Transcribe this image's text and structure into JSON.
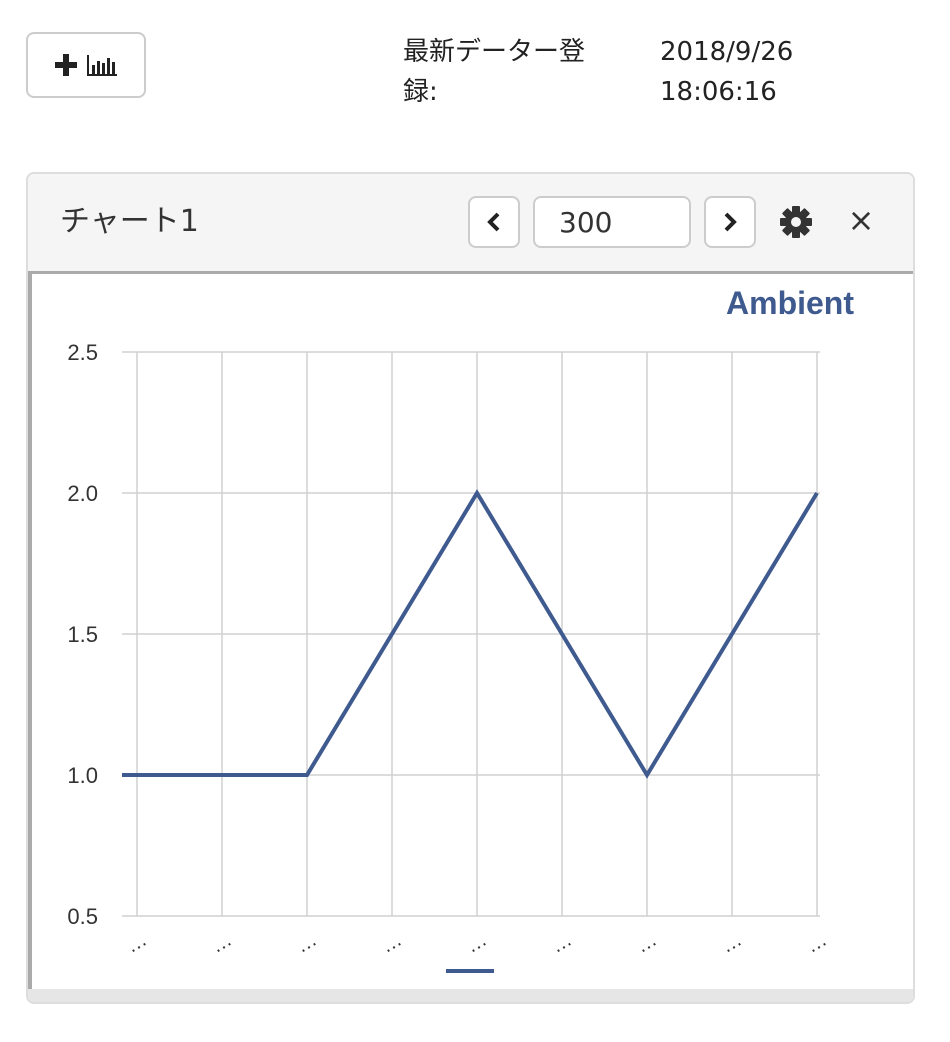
{
  "toolbar": {
    "add_chart_icon": "plus-icon",
    "chart_icon": "bar-chart-icon"
  },
  "latest": {
    "label": "最新データー登録:",
    "date": "2018/9/26",
    "time": "18:06:16"
  },
  "panel": {
    "title": "チャート1",
    "count_value": "300",
    "prev_icon": "chevron-left-icon",
    "next_icon": "chevron-right-icon",
    "settings_icon": "gear-icon",
    "close_label": "×"
  },
  "colors": {
    "series": "#3e5a8f",
    "grid": "#d0d0d0",
    "axis_text": "#333333"
  },
  "chart_data": {
    "type": "line",
    "title": "Ambient",
    "x": [
      "…",
      "…",
      "…",
      "…",
      "…",
      "…",
      "…",
      "…",
      "…"
    ],
    "series": [
      {
        "name": "Ambient",
        "x": [
          0,
          1,
          2,
          4,
          6,
          8
        ],
        "values": [
          1.0,
          1.0,
          1.0,
          2.0,
          1.0,
          2.0
        ]
      }
    ],
    "ylim": [
      0.5,
      2.5
    ],
    "yticks": [
      "0.5",
      "1.0",
      "1.5",
      "2.0",
      "2.5"
    ],
    "grid": true,
    "legend": "bottom"
  }
}
